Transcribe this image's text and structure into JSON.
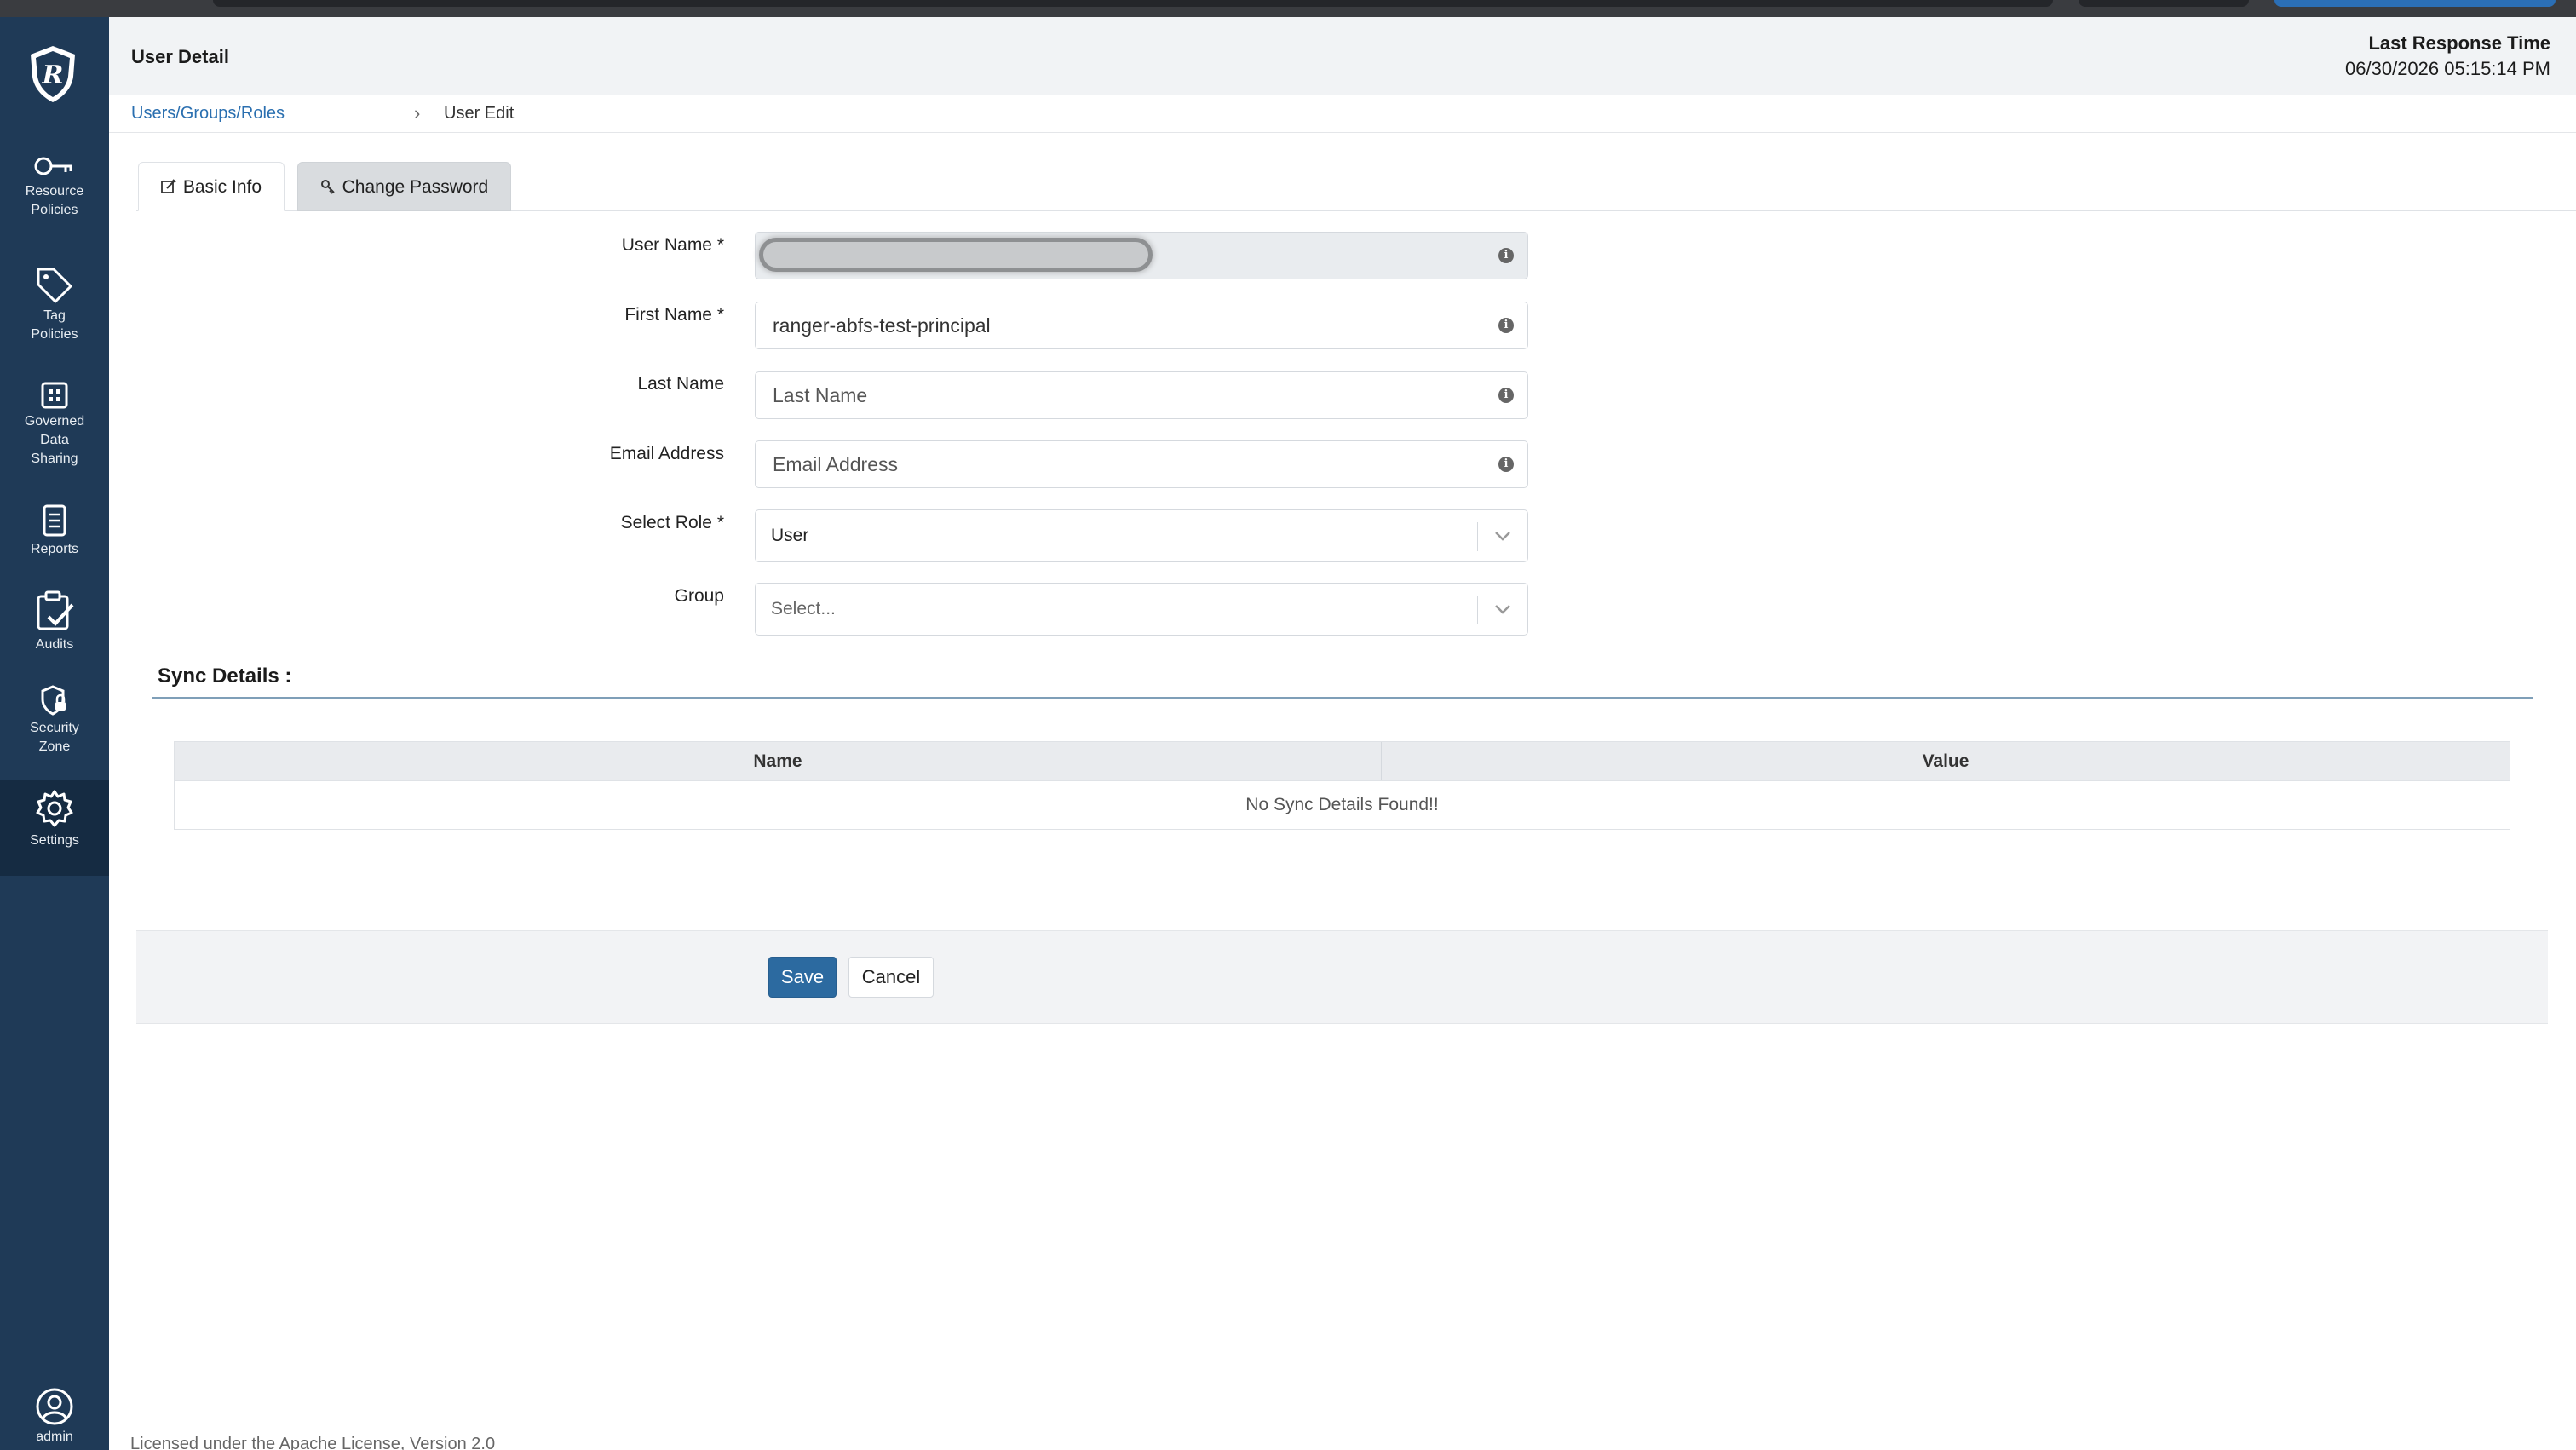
{
  "app": {
    "title": "User Detail"
  },
  "header": {
    "last_response_label": "Last Response Time",
    "last_response_value": "06/30/2026 05:15:14 PM"
  },
  "breadcrumb": {
    "parent": "Users/Groups/Roles",
    "separator": "›",
    "current": "User Edit"
  },
  "sidebar": {
    "items": [
      {
        "label_lines": [
          "Resource",
          "Policies"
        ],
        "icon": "key-icon"
      },
      {
        "label_lines": [
          "Tag",
          "Policies"
        ],
        "icon": "tag-icon"
      },
      {
        "label_lines": [
          "Governed",
          "Data",
          "Sharing"
        ],
        "icon": "grid-icon"
      },
      {
        "label_lines": [
          "Reports"
        ],
        "icon": "report-icon"
      },
      {
        "label_lines": [
          "Audits"
        ],
        "icon": "clipboard-check-icon"
      },
      {
        "label_lines": [
          "Security",
          "Zone"
        ],
        "icon": "shield-lock-icon"
      },
      {
        "label_lines": [
          "Settings"
        ],
        "icon": "gear-icon"
      }
    ],
    "user_label": "admin"
  },
  "tabs": [
    {
      "label": "Basic Info",
      "active": true
    },
    {
      "label": "Change Password",
      "active": false
    }
  ],
  "form": {
    "user_name": {
      "label": "User Name *",
      "value": ""
    },
    "first_name": {
      "label": "First Name *",
      "value": "ranger-abfs-test-principal"
    },
    "last_name": {
      "label": "Last Name",
      "placeholder": "Last Name"
    },
    "email": {
      "label": "Email Address",
      "placeholder": "Email Address"
    },
    "role": {
      "label": "Select Role *",
      "value": "User"
    },
    "group": {
      "label": "Group",
      "placeholder": "Select..."
    },
    "info_glyph": "i"
  },
  "sync": {
    "title": "Sync Details :",
    "columns": [
      "Name",
      "Value"
    ],
    "empty_text": "No Sync Details Found!!"
  },
  "actions": {
    "save": "Save",
    "cancel": "Cancel"
  },
  "footer": {
    "text": "Licensed under the Apache License, Version 2.0"
  },
  "colors": {
    "sidebar": "#1f3a57",
    "primary": "#2c6aa0",
    "link": "#2a6fb0"
  }
}
